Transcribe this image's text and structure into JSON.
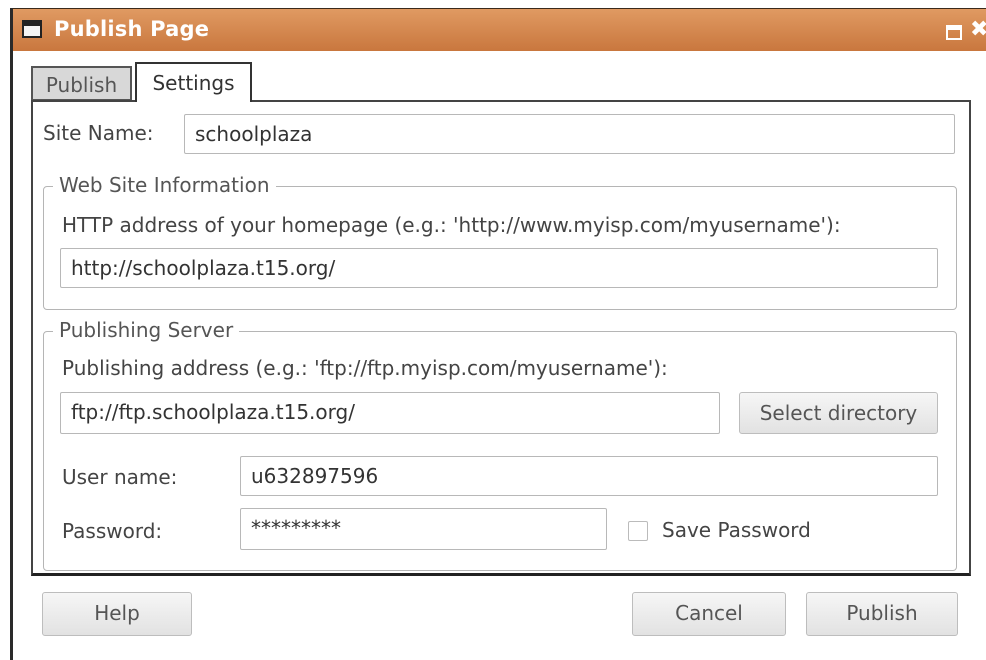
{
  "window": {
    "title": "Publish Page",
    "maximize_icon": "maximize-icon",
    "close_icon": "close-icon",
    "close_glyph": "✖"
  },
  "tabs": [
    {
      "label": "Publish",
      "selected": false
    },
    {
      "label": "Settings",
      "selected": true
    }
  ],
  "settings": {
    "site_name_label": "Site Name:",
    "site_name_value": "schoolplaza",
    "web_site_info": {
      "title": "Web Site Information",
      "http_label": "HTTP address of your homepage (e.g.: 'http://www.myisp.com/myusername'):",
      "http_value": "http://schoolplaza.t15.org/"
    },
    "publishing_server": {
      "title": "Publishing Server",
      "address_label": "Publishing address (e.g.: 'ftp://ftp.myisp.com/myusername'):",
      "address_value": "ftp://ftp.schoolplaza.t15.org/",
      "select_directory_label": "Select directory",
      "username_label": "User name:",
      "username_value": "u632897596",
      "password_label": "Password:",
      "password_value": "*********",
      "save_password_label": "Save Password",
      "save_password_checked": false
    }
  },
  "footer": {
    "help_label": "Help",
    "cancel_label": "Cancel",
    "publish_label": "Publish"
  },
  "colors": {
    "titlebar": "#d5874c",
    "title_text": "#ffffff"
  }
}
